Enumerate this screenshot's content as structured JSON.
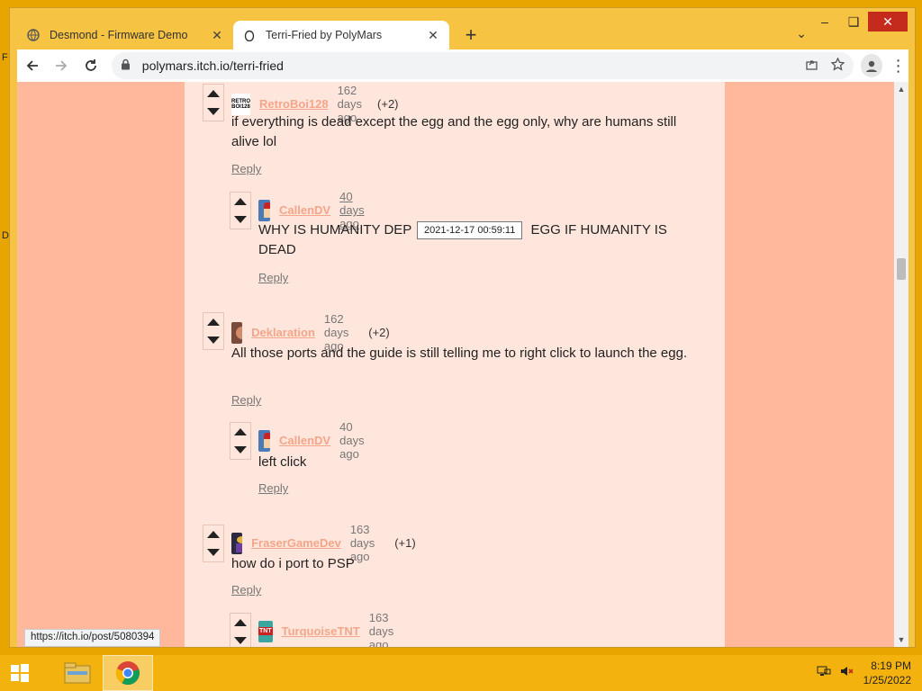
{
  "browser": {
    "tabs": [
      {
        "title": "Desmond - Firmware Demo",
        "active": false
      },
      {
        "title": "Terri-Fried by PolyMars",
        "active": true
      }
    ],
    "url": "polymars.itch.io/terri-fried"
  },
  "page": {
    "comments": [
      {
        "author": "RetroBoi128",
        "ago": "162 days ago",
        "score": "(+2)",
        "body": "if everything is dead except the egg and the egg only, why are humans still alive lol",
        "reply": "Reply"
      },
      {
        "author": "CallenDV",
        "ago": "40 days ago",
        "score": "",
        "body_left": "WHY IS HUMANITY DEP",
        "body_right": " EGG IF HUMANITY IS DEAD",
        "reply": "Reply"
      },
      {
        "author": "Deklaration",
        "ago": "162 days ago",
        "score": "(+2)",
        "body": "All those ports and the guide is still telling me to right click to launch the egg.",
        "reply": "Reply"
      },
      {
        "author": "CallenDV",
        "ago": "40 days ago",
        "score": "",
        "body": "left click",
        "reply": "Reply"
      },
      {
        "author": "FraserGameDev",
        "ago": "163 days ago",
        "score": "(+1)",
        "body": "how do i port to PSP",
        "reply": "Reply"
      },
      {
        "author": "TurquoiseTNT",
        "ago": "163 days ago",
        "score": "",
        "body": "",
        "reply": ""
      }
    ],
    "tooltip": "2021-12-17 00:59:11",
    "avatar_text_1": "RETRO BOI128",
    "avatar_text_6": "TNT"
  },
  "statusbar": {
    "url": "https://itch.io/post/5080394"
  },
  "taskbar": {
    "time": "8:19 PM",
    "date": "1/25/2022"
  },
  "desktop_glyphs": [
    "F",
    "D"
  ],
  "colors": {
    "page_bg": "#ffb89c",
    "content_bg": "#ffe6dc",
    "author_link": "#f4a58a",
    "taskbar": "#f4b20f"
  }
}
